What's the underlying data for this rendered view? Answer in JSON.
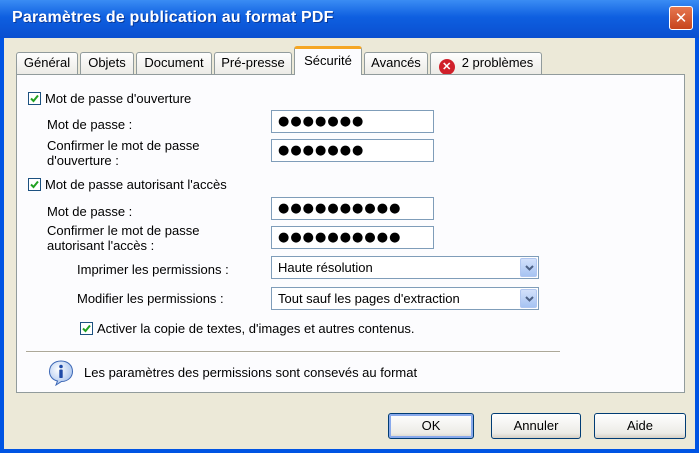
{
  "window": {
    "title": "Paramètres de publication au format PDF",
    "close_label": "✕"
  },
  "tabs": [
    {
      "label": "Général",
      "active": false
    },
    {
      "label": "Objets",
      "active": false
    },
    {
      "label": "Document",
      "active": false
    },
    {
      "label": "Pré-presse",
      "active": false
    },
    {
      "label": "Sécurité",
      "active": true
    },
    {
      "label": "Avancés",
      "active": false
    },
    {
      "label": "2 problèmes",
      "active": false,
      "icon": "error-icon"
    }
  ],
  "security": {
    "open_password": {
      "checkbox_label": "Mot de passe d'ouverture",
      "checked": true,
      "password_label": "Mot de passe :",
      "password_value": "●●●●●●●",
      "confirm_label_line1": "Confirmer le mot de passe",
      "confirm_label_line2": "d'ouverture :",
      "confirm_value": "●●●●●●●"
    },
    "access_password": {
      "checkbox_label": "Mot de passe autorisant l'accès",
      "checked": true,
      "password_label": "Mot de passe :",
      "password_value": "●●●●●●●●●●",
      "confirm_label_line1": "Confirmer le mot de passe",
      "confirm_label_line2": "autorisant l'accès :",
      "confirm_value": "●●●●●●●●●●"
    },
    "print_permissions": {
      "label": "Imprimer les permissions :",
      "value": "Haute résolution"
    },
    "modify_permissions": {
      "label": "Modifier les permissions :",
      "value": "Tout sauf les pages d'extraction"
    },
    "copy_content": {
      "label": "Activer la copie de textes, d'images et autres contenus.",
      "checked": true
    }
  },
  "info": {
    "text": "Les paramètres des permissions sont consevés au format",
    "icon": "info-icon"
  },
  "buttons": {
    "ok": "OK",
    "cancel": "Annuler",
    "help": "Aide"
  },
  "colors": {
    "titlebar": "#0a4fd0",
    "active_tab_accent": "#f5a623",
    "error": "#d0202a",
    "dialog_bg": "#ece9d8"
  }
}
